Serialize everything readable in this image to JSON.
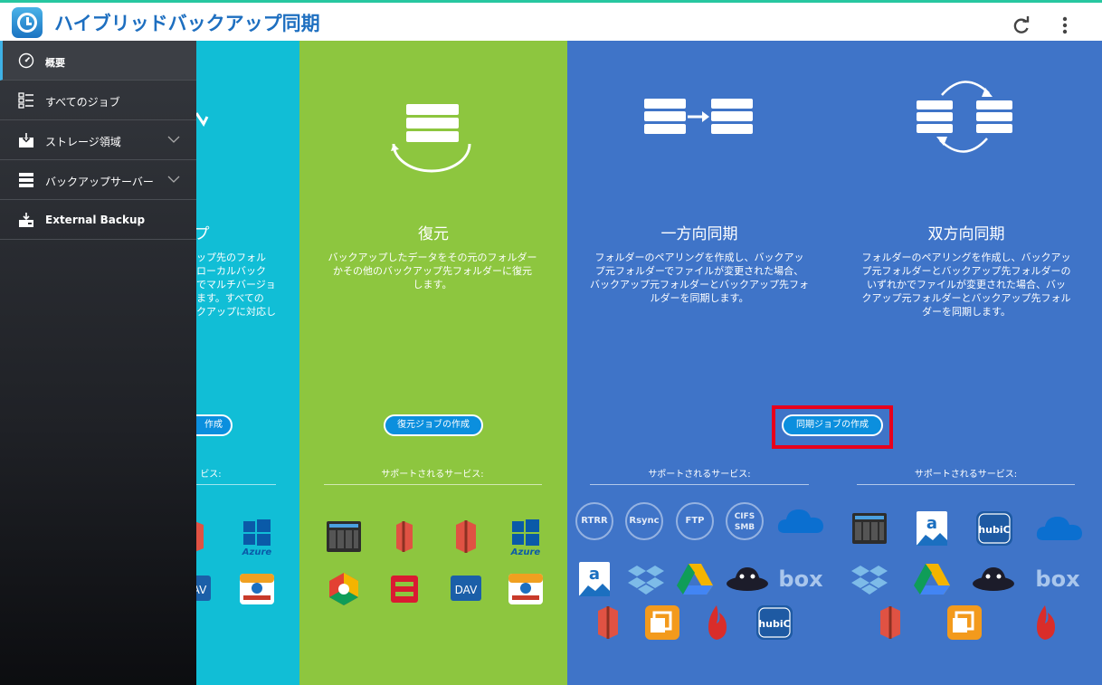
{
  "app": {
    "title": "ハイブリッドバックアップ同期"
  },
  "header": {
    "refresh_icon": "refresh-icon",
    "more_icon": "more-vertical-icon"
  },
  "sidebar": {
    "items": [
      {
        "label": "概要",
        "icon": "dashboard-icon",
        "active": true
      },
      {
        "label": "すべてのジョブ",
        "icon": "job-list-icon"
      },
      {
        "label": "ストレージ領域",
        "icon": "storage-icon",
        "expandable": true
      },
      {
        "label": "バックアップサーバー",
        "icon": "server-icon",
        "expandable": true
      },
      {
        "label": "External Backup",
        "icon": "external-backup-icon"
      }
    ]
  },
  "panels": {
    "backup": {
      "title_partial": "プ",
      "desc_partial": [
        "ップ先のフォル",
        "ローカルバック",
        "でマルチバージョ",
        "ます。すべての",
        "クアップに対応し"
      ],
      "button_partial": "作成",
      "supported_partial": "ビス:",
      "services": [
        "amazon-s3",
        "azure",
        "webdav",
        "infinite-backup"
      ],
      "azure_label": "Azure",
      "dav_label": "DAV"
    },
    "restore": {
      "title": "復元",
      "desc": [
        "バックアップしたデータをその元のフォルダー",
        "かその他のバックアップ先フォルダーに復元",
        "します。"
      ],
      "button": "復元ジョブの作成",
      "supported": "サポートされるサービス:",
      "services": [
        "qnap-nas",
        "amazon-s3",
        "amazon-s3",
        "azure",
        "google-cloud",
        "openstack",
        "webdav",
        "infinite-backup"
      ],
      "azure_label": "Azure",
      "dav_label": "DAV"
    },
    "one_way": {
      "title": "一方向同期",
      "desc": [
        "フォルダーのペアリングを作成し、バックアッ",
        "プ元フォルダーでファイルが変更された場合、",
        "バックアップ元フォルダーとバックアップ先フォ",
        "ルダーを同期します。"
      ],
      "button": "同期ジョブの作成",
      "supported": "サポートされるサービス:",
      "circle_services": [
        "RTRR",
        "Rsync",
        "FTP"
      ],
      "cifs_line1": "CIFS",
      "cifs_line2": "SMB",
      "box_label": "box",
      "hubic_label": "hubiC"
    },
    "two_way": {
      "title": "双方向同期",
      "desc": [
        "フォルダーのペアリングを作成し、バックアッ",
        "プ元フォルダーとバックアップ先フォルダーの",
        "いずれかでファイルが変更された場合、バッ",
        "クアップ元フォルダーとバックアップ先フォル",
        "ダーを同期します。"
      ],
      "supported": "サポートされるサービス:",
      "box_label": "box",
      "hubic_label": "hubiC"
    }
  },
  "colors": {
    "backup_panel": "#11bed6",
    "restore_panel": "#8dc63f",
    "sync_panel": "#3f74c8",
    "highlight": "#e8001c"
  }
}
